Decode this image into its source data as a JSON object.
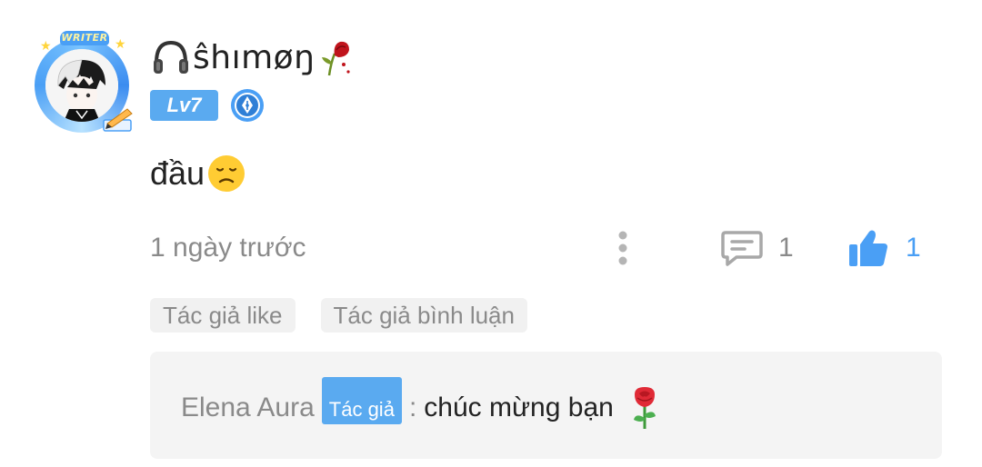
{
  "comment": {
    "author": {
      "name": "ŝhımøŋ",
      "frame_label": "WRITER",
      "level": "Lv7",
      "avatar_icon": "anime-avatar-icon",
      "medal_icon": "pen-medal-icon"
    },
    "text": "đầu",
    "text_emoji": "sad-face-emoji",
    "timestamp": "1 ngày trước",
    "actions": {
      "more_icon": "more-vertical-icon",
      "reply_icon": "comment-icon",
      "reply_count": "1",
      "like_icon": "thumbs-up-icon",
      "like_count": "1"
    },
    "tags": [
      "Tác giả like",
      "Tác giả bình luận"
    ],
    "reply": {
      "author": "Elena Aura",
      "author_tag": "Tác giả",
      "separator": ":",
      "text": "chúc mừng bạn",
      "emoji": "rose-emoji"
    }
  },
  "colors": {
    "accent": "#4a9ff5",
    "badge": "#5aaaf0",
    "text": "#222222",
    "muted": "#8a8a8a",
    "tag_bg": "#f1f1f1",
    "reply_bg": "#f4f4f4"
  }
}
